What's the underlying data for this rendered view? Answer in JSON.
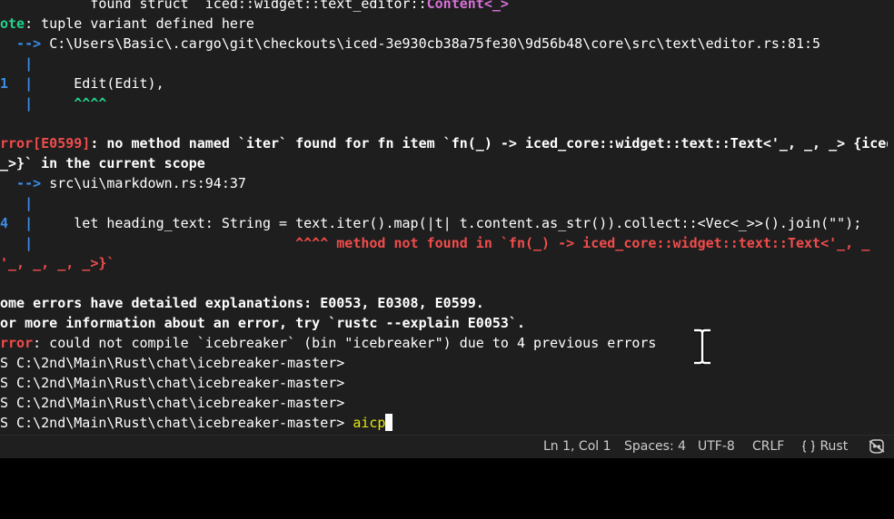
{
  "terminal": {
    "lines": [
      {
        "segs": [
          {
            "t": "           found struct `iced::widget::text_editor::",
            "c": "white"
          },
          {
            "t": "Content<_>",
            "c": "purple bold"
          },
          {
            "t": "`",
            "c": "white"
          }
        ]
      },
      {
        "segs": [
          {
            "t": "ote",
            "c": "green bold"
          },
          {
            "t": ": tuple variant defined here",
            "c": "white"
          }
        ]
      },
      {
        "segs": [
          {
            "t": "  --> ",
            "c": "blue bold"
          },
          {
            "t": "C:\\Users\\Basic\\.cargo\\git\\checkouts\\iced-3e930cb38a75fe30\\9d56b48\\core\\src\\text\\editor.rs:81:5",
            "c": "white"
          }
        ]
      },
      {
        "segs": [
          {
            "t": "   |",
            "c": "blue bold"
          }
        ]
      },
      {
        "segs": [
          {
            "t": "1  |",
            "c": "blue bold"
          },
          {
            "t": "     Edit(Edit),",
            "c": "white"
          }
        ]
      },
      {
        "segs": [
          {
            "t": "   |",
            "c": "blue bold"
          },
          {
            "t": "     ^^^^",
            "c": "green bold"
          }
        ]
      },
      {
        "segs": []
      },
      {
        "segs": [
          {
            "t": "rror[E0599]",
            "c": "red bold"
          },
          {
            "t": ": no method named `iter` found for fn item `fn(_) -> iced_core::widget::text::Text<'_, _, _> {iced:",
            "c": "white bold"
          }
        ]
      },
      {
        "segs": [
          {
            "t": "_>}` in the current scope",
            "c": "white bold"
          }
        ]
      },
      {
        "segs": [
          {
            "t": "  --> ",
            "c": "blue bold"
          },
          {
            "t": "src\\ui\\markdown.rs:94:37",
            "c": "white"
          }
        ]
      },
      {
        "segs": [
          {
            "t": "   |",
            "c": "blue bold"
          }
        ]
      },
      {
        "segs": [
          {
            "t": "4  |",
            "c": "blue bold"
          },
          {
            "t": "     let heading_text: String = text.iter().map(|t| t.content.as_str()).collect::<Vec<_>>().join(\"\");",
            "c": "white"
          }
        ]
      },
      {
        "segs": [
          {
            "t": "   |",
            "c": "blue bold"
          },
          {
            "t": "                                ^^^^ method not found in `fn(_) -> iced_core::widget::text::Text<'_, _",
            "c": "red bold"
          }
        ]
      },
      {
        "segs": [
          {
            "t": "'_, _, _, _>}`",
            "c": "red bold"
          }
        ]
      },
      {
        "segs": []
      },
      {
        "segs": [
          {
            "t": "ome errors have detailed explanations: E0053, E0308, E0599.",
            "c": "white bold"
          }
        ]
      },
      {
        "segs": [
          {
            "t": "or more information about an error, try `rustc --explain E0053`.",
            "c": "white bold"
          }
        ]
      },
      {
        "segs": [
          {
            "t": "rror",
            "c": "red bold"
          },
          {
            "t": ": could not compile `icebreaker` (bin \"icebreaker\") due to 4 previous errors",
            "c": "white"
          }
        ]
      },
      {
        "segs": [
          {
            "t": "S C:\\2nd\\Main\\Rust\\chat\\icebreaker-master>",
            "c": "white"
          }
        ]
      },
      {
        "segs": [
          {
            "t": "S C:\\2nd\\Main\\Rust\\chat\\icebreaker-master>",
            "c": "white"
          }
        ]
      },
      {
        "segs": [
          {
            "t": "S C:\\2nd\\Main\\Rust\\chat\\icebreaker-master>",
            "c": "white"
          }
        ]
      },
      {
        "segs": [
          {
            "t": "S C:\\2nd\\Main\\Rust\\chat\\icebreaker-master> ",
            "c": "white"
          },
          {
            "t": "aicp",
            "c": "yellow"
          }
        ]
      }
    ]
  },
  "statusbar": {
    "position": "Ln 1, Col 1",
    "spaces": "Spaces: 4",
    "encoding": "UTF-8",
    "eol": "CRLF",
    "language": "Rust",
    "icons": {
      "language": "braces-icon",
      "copilot": "copilot-icon"
    }
  },
  "colors": {
    "error": "#f14c4c",
    "arrow": "#3b8eea",
    "note": "#23d18b",
    "type": "#d670d6",
    "command": "#e5e510",
    "background": "#1e1e1e"
  }
}
